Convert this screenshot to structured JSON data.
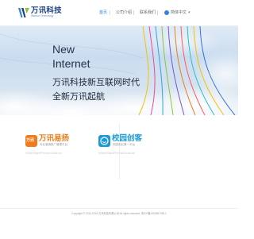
{
  "brand": {
    "name": "万讯科技",
    "tagline": "Wanxun Technology",
    "colors": {
      "primary": "#2f86d6",
      "dark": "#1c3f80",
      "accent": "#8fc43a"
    }
  },
  "nav": {
    "items": [
      {
        "label": "首页",
        "active": true
      },
      {
        "label": "公司介绍",
        "active": false
      },
      {
        "label": "联系我们",
        "active": false
      }
    ],
    "language": {
      "label": "简体中文",
      "icon": "chevron-down-icon"
    }
  },
  "hero": {
    "line1": "New",
    "line2": "Internet",
    "line3": "万讯科技新互联网时代",
    "line4": "全新万讯起航"
  },
  "products": [
    {
      "title": "万讯易扬",
      "subtitle": "专业营销推广管理平台",
      "platforms": "Web/Wap/iPhone/Android",
      "icon_label": "万讯",
      "icon_color": "#f07d1a",
      "title_color": "#f07d1a"
    },
    {
      "title": "校园创客",
      "subtitle": "校园创业第一平台",
      "platforms": "Web/Wap/iPhone/Android",
      "icon_color": "#1e9ad6",
      "title_color": "#1e9ad6"
    }
  ],
  "footer": {
    "copyright": "Copyright © 2014-2015 万讯科技有限公司 All rights reserved. 粤ICP备14045670号-1"
  }
}
